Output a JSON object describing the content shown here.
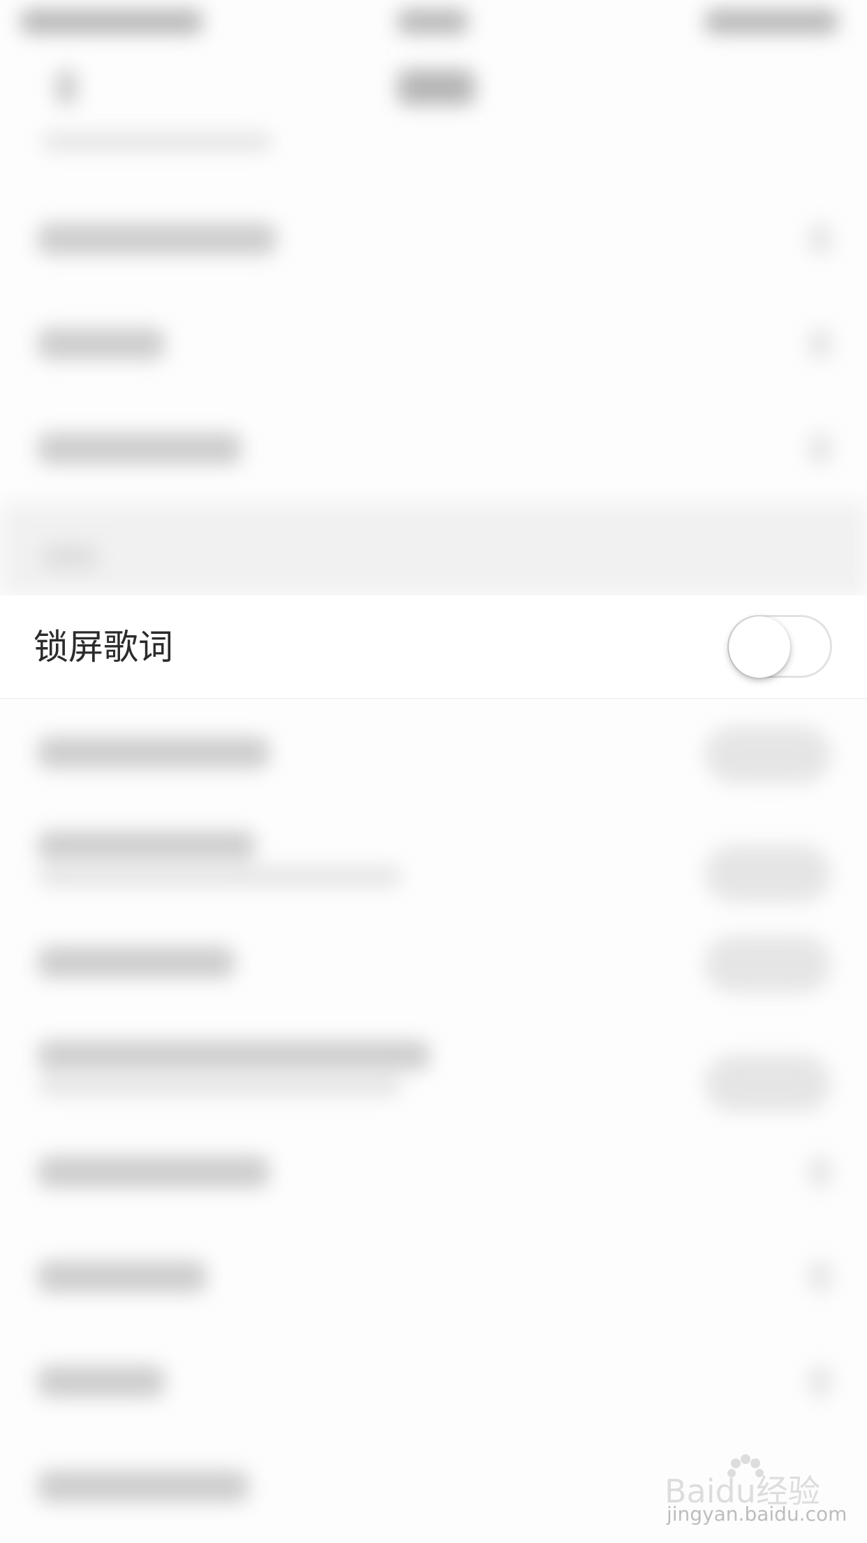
{
  "settings": {
    "lock_screen_lyrics": {
      "label": "锁屏歌词",
      "enabled": false
    }
  },
  "watermark": {
    "logo_text": "Baidu经验",
    "sub_text": "jingyan.baidu.com"
  }
}
